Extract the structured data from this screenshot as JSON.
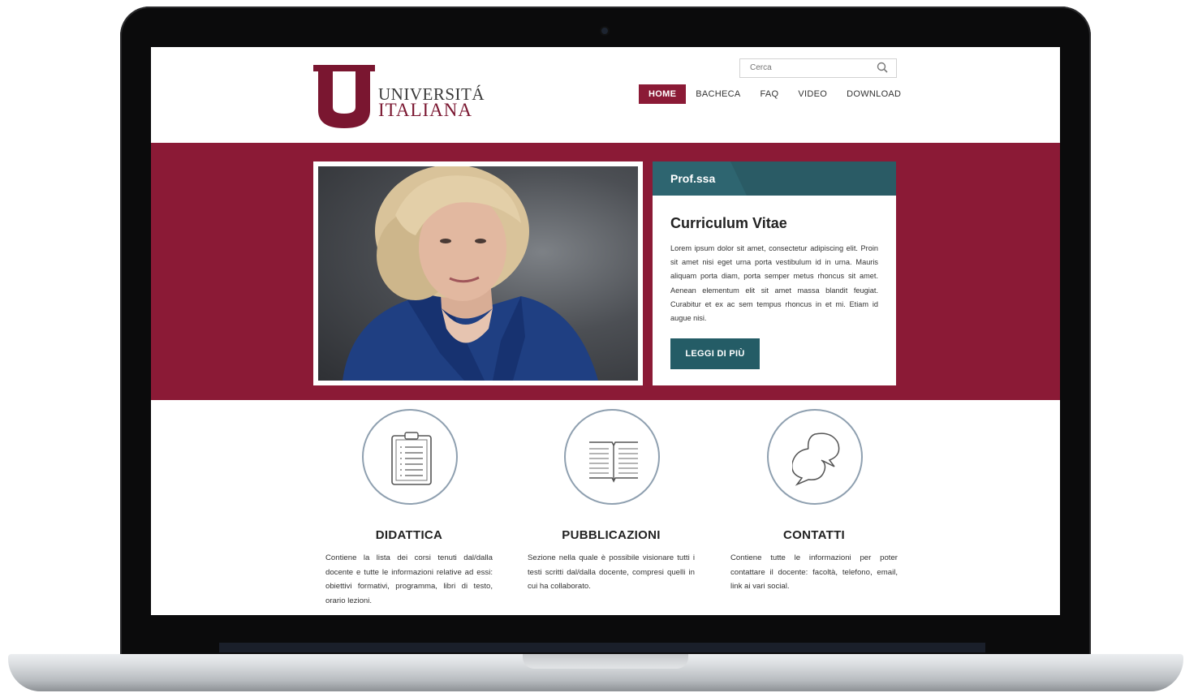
{
  "header": {
    "logo_line1": "UNIVERSITÁ",
    "logo_line2": "ITALIANA",
    "search_placeholder": "Cerca"
  },
  "nav": {
    "items": [
      {
        "label": "HOME",
        "active": true
      },
      {
        "label": "BACHECA",
        "active": false
      },
      {
        "label": "FAQ",
        "active": false
      },
      {
        "label": "VIDEO",
        "active": false
      },
      {
        "label": "DOWNLOAD",
        "active": false
      }
    ]
  },
  "profile_card": {
    "label": "Prof.ssa",
    "title": "Curriculum Vitae",
    "text": "Lorem ipsum dolor sit amet, consectetur adipiscing elit. Proin sit amet nisi eget urna porta vestibulum id in urna. Mauris aliquam porta diam, porta semper metus rhoncus sit amet. Aenean elementum elit sit amet massa blandit feugiat. Curabitur et ex ac sem tempus rhoncus in et mi. Etiam id augue nisi.",
    "button_label": "LEGGI DI PIÙ"
  },
  "features": [
    {
      "title": "DIDATTICA",
      "text": "Contiene la lista dei corsi tenuti dal/dalla docente e tutte le informazioni relative ad essi: obiettivi formativi, programma, libri di testo, orario lezioni.",
      "icon": "clipboard-icon"
    },
    {
      "title": "PUBBLICAZIONI",
      "text": "Sezione nella quale è possibile visionare tutti i testi scritti dal/dalla docente, compresi quelli in cui ha collaborato.",
      "icon": "open-book-icon"
    },
    {
      "title": "CONTATTI",
      "text": "Contiene tutte le informazioni per poter contattare il docente: facoltà, telefono, email, link ai vari social.",
      "icon": "chat-bubbles-icon"
    }
  ],
  "colors": {
    "brand": "#8b1a36",
    "teal": "#2e6570",
    "button": "#245c66"
  }
}
